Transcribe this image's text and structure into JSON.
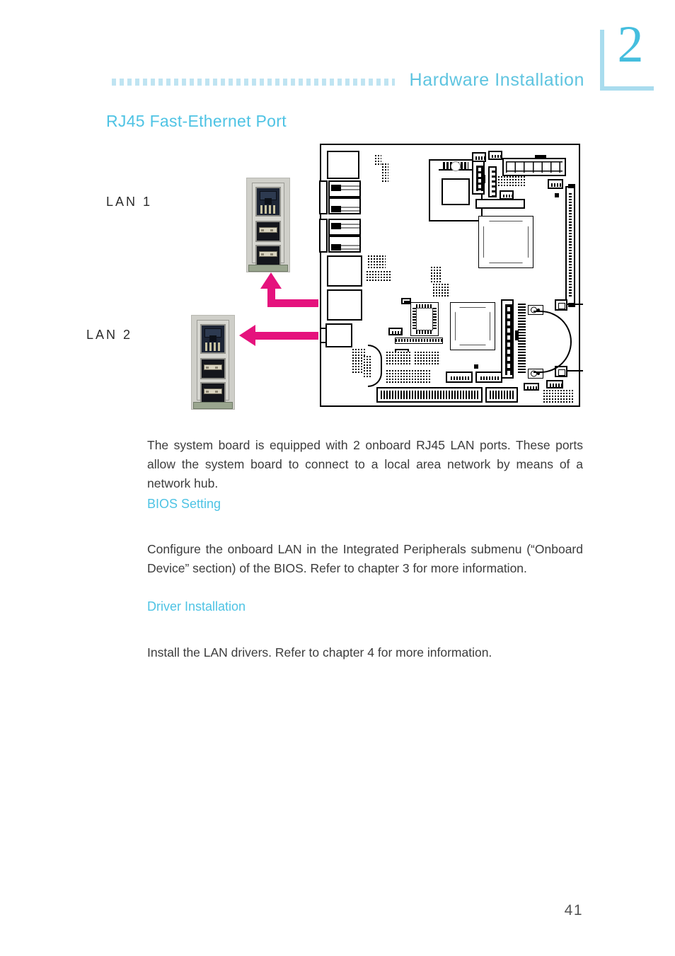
{
  "header": {
    "chapter_number": "2",
    "title": "Hardware  Installation",
    "rule_icon": "dotted-rule"
  },
  "section": {
    "title": "RJ45 Fast-Ethernet Port"
  },
  "figure": {
    "lan1_label": "LAN  1",
    "lan2_label": "LAN  2",
    "arrow_color": "#e5127d",
    "arrow1_icon": "arrow-up-elbow",
    "arrow2_icon": "arrow-left",
    "board_caption": ""
  },
  "content": {
    "intro_paragraph": "The system board is equipped with 2 onboard RJ45 LAN ports. These ports allow the system board to connect to a local area network by means of a network hub.",
    "bios_heading": "BIOS Setting",
    "bios_paragraph": "Configure the onboard LAN in the Integrated Peripherals submenu (“Onboard Device” section) of the BIOS. Refer to chapter 3 for more information.",
    "driver_heading": "Driver Installation",
    "driver_paragraph": "Install the LAN drivers. Refer to chapter 4 for more information."
  },
  "footer": {
    "page_number": "41"
  },
  "colors": {
    "accent_cyan": "#4ec3e4",
    "header_cyan": "#5ec4e0",
    "rule_light_blue": "#bfe4f2",
    "bracket_blue": "#a9dcee",
    "arrow_magenta": "#e5127d",
    "body_text": "#3c3c3c"
  }
}
